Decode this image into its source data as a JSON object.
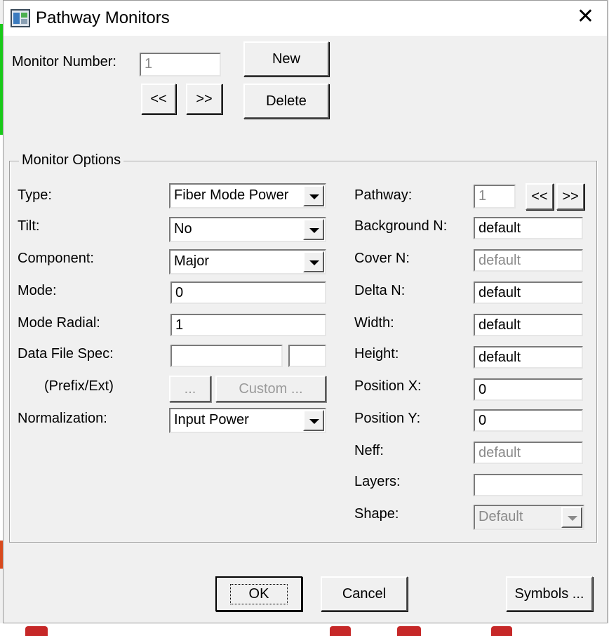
{
  "window": {
    "title": "Pathway Monitors",
    "close_symbol": "✕"
  },
  "monitor": {
    "number_label": "Monitor Number:",
    "number_value": "1",
    "prev_label": "<<",
    "next_label": ">>",
    "new_label": "New",
    "delete_label": "Delete"
  },
  "options": {
    "group_title": "Monitor Options",
    "type": {
      "label": "Type:",
      "value": "Fiber Mode Power"
    },
    "tilt": {
      "label": "Tilt:",
      "value": "No"
    },
    "component": {
      "label": "Component:",
      "value": "Major"
    },
    "mode": {
      "label": "Mode:",
      "value": "0"
    },
    "mode_radial": {
      "label": "Mode Radial:",
      "value": "1"
    },
    "data_file_spec": {
      "label": "Data File Spec:",
      "prefix_value": "",
      "ext_value": ""
    },
    "prefix_ext": {
      "label": "(Prefix/Ext)",
      "browse_label": "...",
      "custom_label": "Custom ..."
    },
    "normalization": {
      "label": "Normalization:",
      "value": "Input Power"
    },
    "pathway": {
      "label": "Pathway:",
      "value": "1",
      "prev_label": "<<",
      "next_label": ">>"
    },
    "background_n": {
      "label": "Background N:",
      "value": "default"
    },
    "cover_n": {
      "label": "Cover N:",
      "value": "default"
    },
    "delta_n": {
      "label": "Delta N:",
      "value": "default"
    },
    "width": {
      "label": "Width:",
      "value": "default"
    },
    "height": {
      "label": "Height:",
      "value": "default"
    },
    "position_x": {
      "label": "Position X:",
      "value": "0"
    },
    "position_y": {
      "label": "Position Y:",
      "value": "0"
    },
    "neff": {
      "label": "Neff:",
      "value": "default"
    },
    "layers": {
      "label": "Layers:",
      "value": ""
    },
    "shape": {
      "label": "Shape:",
      "value": "Default"
    }
  },
  "footer": {
    "ok_label": "OK",
    "cancel_label": "Cancel",
    "symbols_label": "Symbols ..."
  }
}
